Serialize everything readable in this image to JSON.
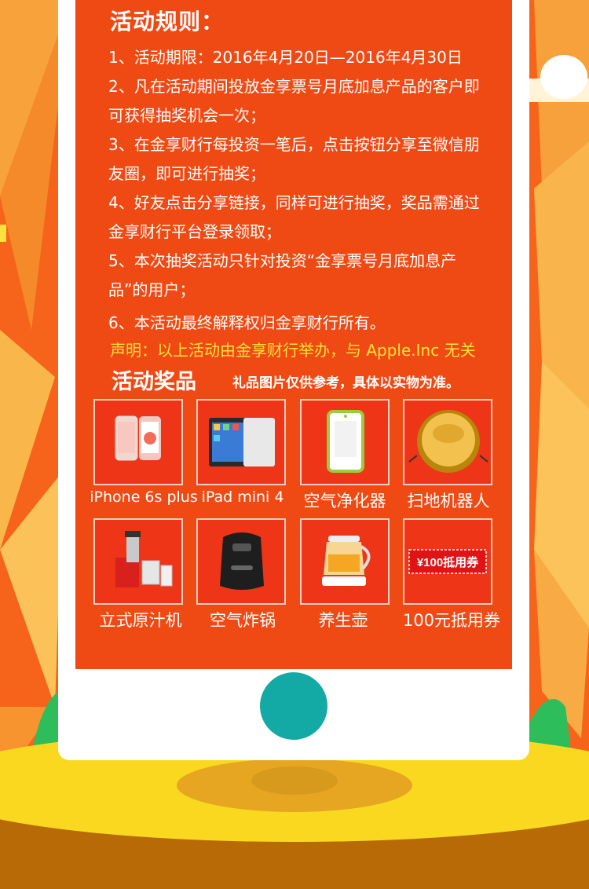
{
  "rules": {
    "title": "活动规则：",
    "items": [
      "1、活动期限：2016年4月20日—2016年4月30日",
      "2、凡在活动期间投放金享票号月底加息产品的客户即可获得抽奖机会一次；",
      "3、在金享财行每投资一笔后，点击按钮分享至微信朋友圈，即可进行抽奖；",
      "4、好友点击分享链接，同样可进行抽奖，奖品需通过金享财行平台登录领取；",
      "5、本次抽奖活动只针对投资“金享票号月底加息产品”的用户；",
      "6、本活动最终解释权归金享财行所有。"
    ],
    "statement": "声明：以上活动由金享财行举办，与 Apple.Inc 无关"
  },
  "prizes": {
    "title": "活动奖品",
    "note": "礼品图片仅供参考，具体以实物为准。",
    "items": [
      {
        "label": "iPhone 6s plus",
        "icon": "iphone-icon"
      },
      {
        "label": "iPad mini 4",
        "icon": "ipad-icon"
      },
      {
        "label": "空气净化器",
        "icon": "air-purifier-icon"
      },
      {
        "label": "扫地机器人",
        "icon": "robot-vacuum-icon"
      },
      {
        "label": "立式原汁机",
        "icon": "juicer-icon"
      },
      {
        "label": "空气炸锅",
        "icon": "air-fryer-icon"
      },
      {
        "label": "养生壶",
        "icon": "health-kettle-icon"
      },
      {
        "label": "100元抵用券",
        "icon": "voucher-icon"
      }
    ],
    "voucher_text": "¥100抵用券"
  },
  "colors": {
    "background": "#f5641a",
    "screen": "#f04a14",
    "statement": "#ffe23d",
    "home_button": "#13aaa6",
    "tile": "#ee3517"
  }
}
